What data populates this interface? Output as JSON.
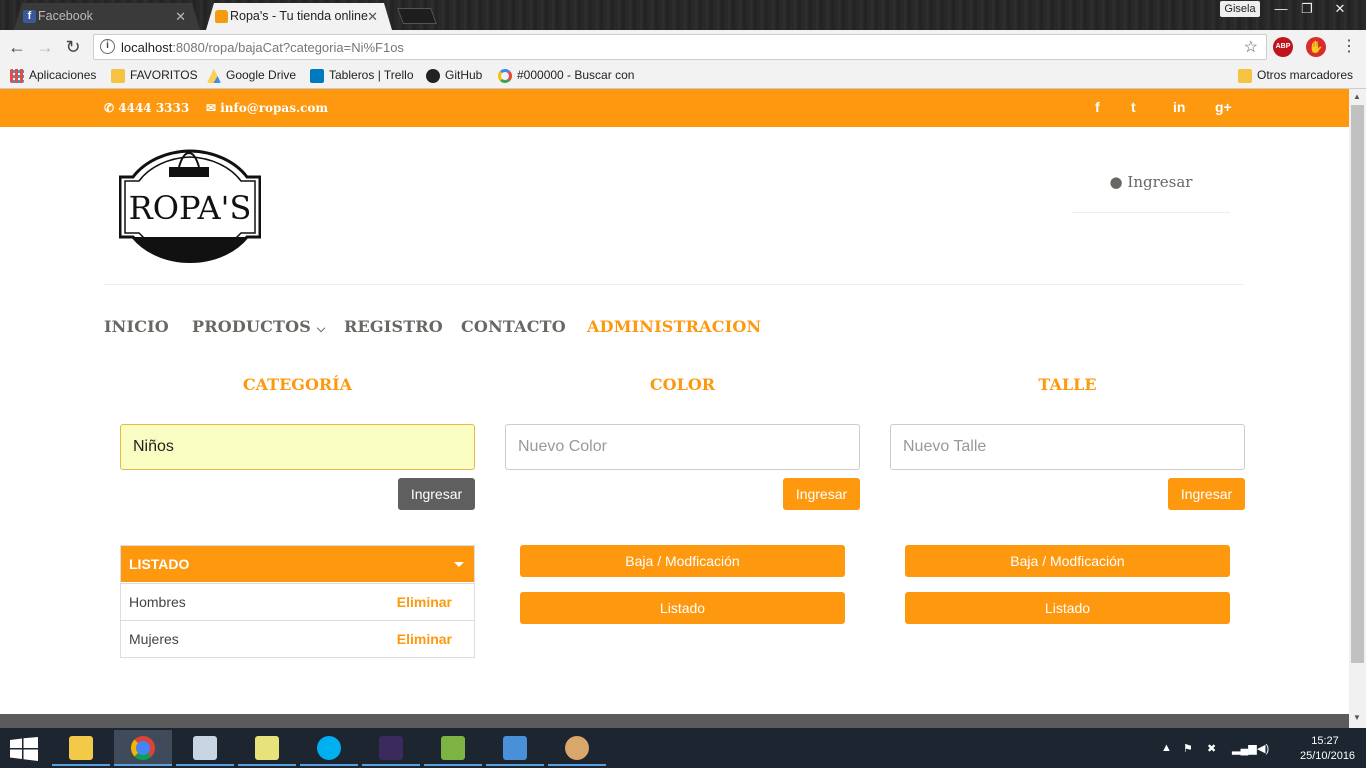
{
  "browser": {
    "tabs": [
      {
        "title": "Facebook",
        "active": false
      },
      {
        "title": "Ropa's - Tu tienda online",
        "active": true
      }
    ],
    "window_user": "Gisela",
    "url_host": "localhost",
    "url_rest": ":8080/ropa/bajaCat?categoria=Ni%F1os",
    "extensions": [
      "ABP",
      "adblock-icon"
    ],
    "bookmarks": [
      {
        "label": "Aplicaciones",
        "icon": "apps-grid-icon"
      },
      {
        "label": "FAVORITOS",
        "icon": "folder-icon"
      },
      {
        "label": "Google Drive",
        "icon": "google-drive-icon"
      },
      {
        "label": "Tableros | Trello",
        "icon": "trello-icon"
      },
      {
        "label": "GitHub",
        "icon": "github-icon"
      },
      {
        "label": "#000000 - Buscar con",
        "icon": "google-icon"
      }
    ],
    "other_bookmarks": "Otros marcadores"
  },
  "topbar": {
    "phone": "4444 3333",
    "email": "info@ropas.com",
    "social": [
      "f",
      "t",
      "in",
      "g+"
    ]
  },
  "header": {
    "logo_text": "ROPA'S",
    "login_label": "Ingresar"
  },
  "nav": {
    "items": [
      "INICIO",
      "PRODUCTOS",
      "REGISTRO",
      "CONTACTO",
      "ADMINISTRACION"
    ],
    "active": "ADMINISTRACION"
  },
  "columns": [
    {
      "title": "CATEGORÍA",
      "input_value": "Niños",
      "placeholder": "",
      "button": "Ingresar"
    },
    {
      "title": "COLOR",
      "input_value": "",
      "placeholder": "Nuevo Color",
      "button": "Ingresar"
    },
    {
      "title": "TALLE",
      "input_value": "",
      "placeholder": "Nuevo Talle",
      "button": "Ingresar"
    }
  ],
  "listado_panel": {
    "header": "LISTADO",
    "rows": [
      {
        "name": "Hombres",
        "action": "Eliminar"
      },
      {
        "name": "Mujeres",
        "action": "Eliminar"
      }
    ]
  },
  "color_actions": [
    "Baja / Modficación",
    "Listado"
  ],
  "talle_actions": [
    "Baja / Modficación",
    "Listado"
  ],
  "taskbar": {
    "time": "15:27",
    "date": "25/10/2016"
  },
  "colors": {
    "accent": "#fe980f",
    "text": "#696763"
  }
}
